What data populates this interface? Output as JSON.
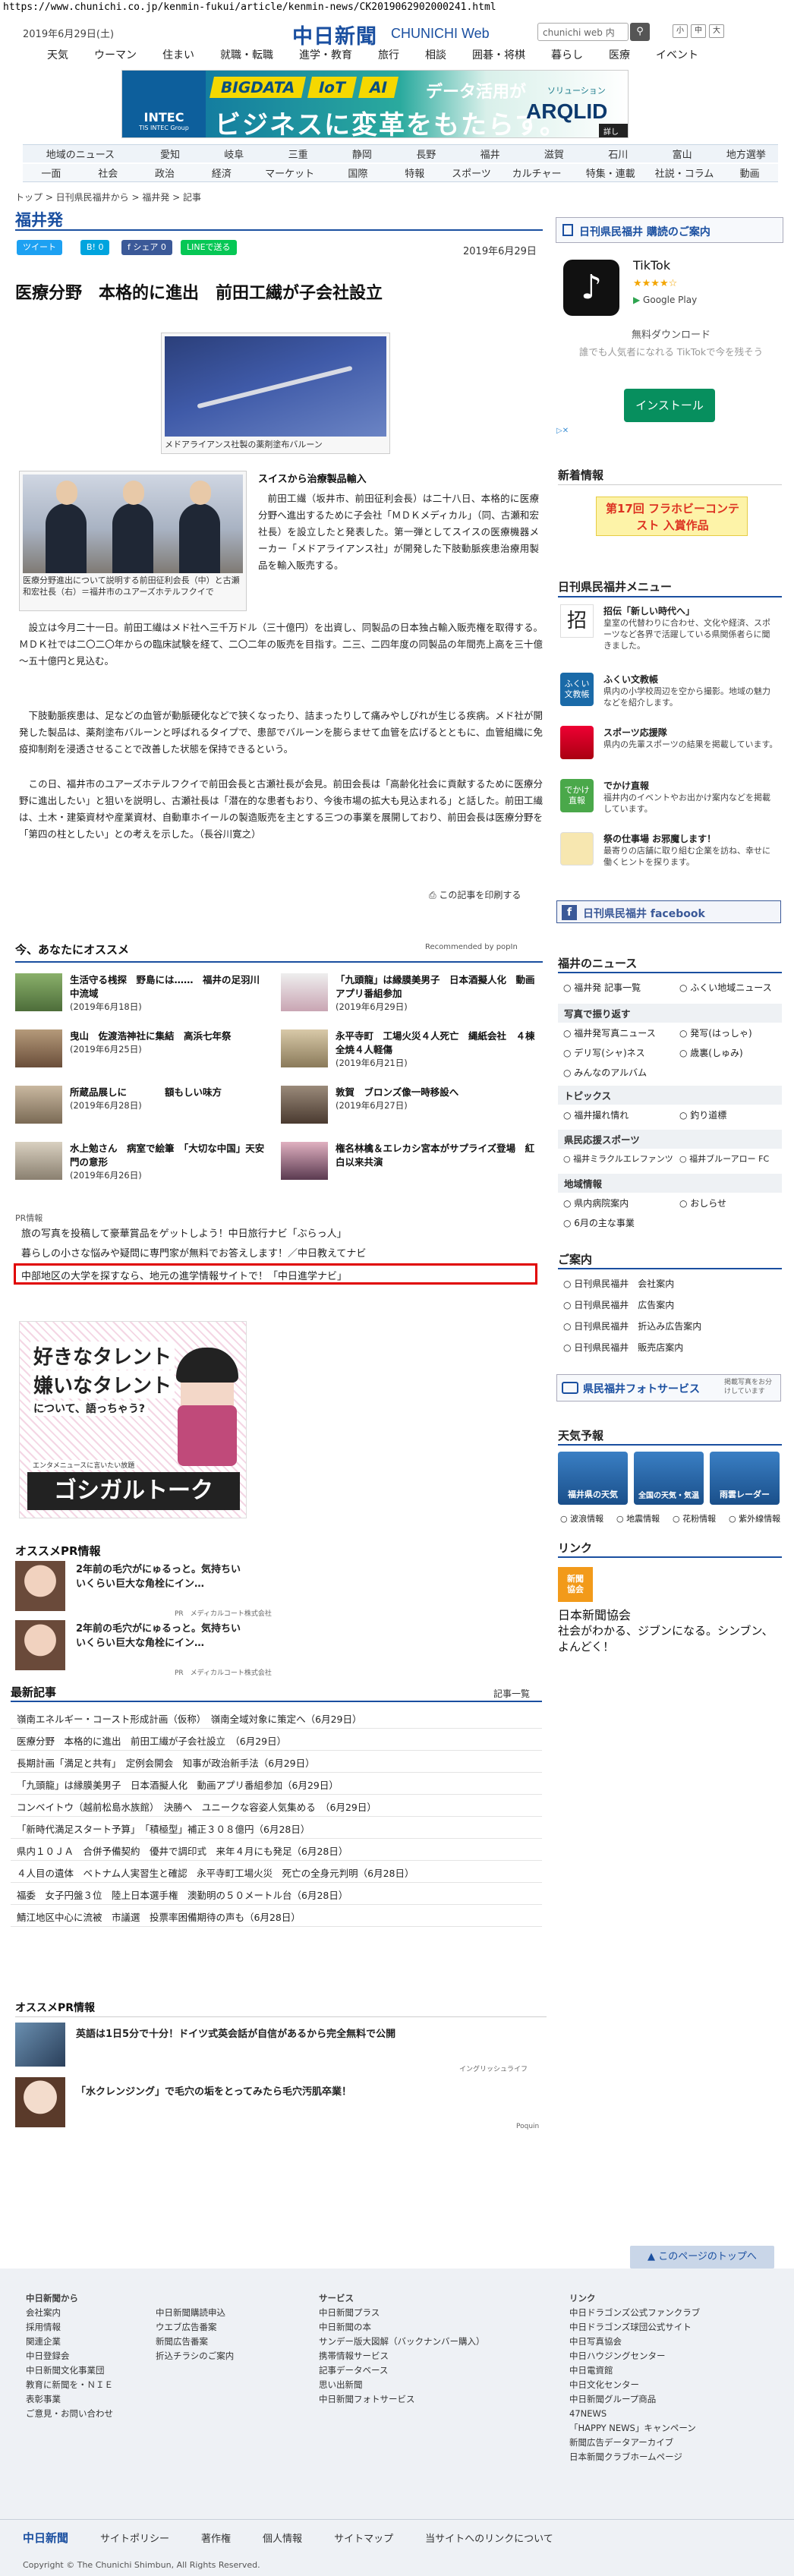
{
  "url": "https://www.chunichi.co.jp/kenmin-fukui/article/kenmin-news/CK2019062902000241.html",
  "header": {
    "date": "2019年6月29日(土)",
    "logo": "中日新聞",
    "logo_sub": "CHUNICHI Web",
    "search_placeholder": "chunichi web 内",
    "search_icon": "search-icon",
    "font_small": "小",
    "font_mid": "中",
    "font_large": "大",
    "nav": [
      "天気",
      "ウーマン",
      "住まい",
      "就職・転職",
      "進学・教育",
      "旅行",
      "相談",
      "囲碁・将棋",
      "暮らし",
      "医療",
      "イベント"
    ]
  },
  "banner": {
    "tags": [
      "BIGDATA",
      "IoT",
      "AI"
    ],
    "data": "データ活用が",
    "main": "ビジネスに変革をもたらす。",
    "company": "INTEC",
    "company_sub": "TIS INTEC Group",
    "product": "ARQLID",
    "product_sub": "ソリューション",
    "detail": "詳しくは"
  },
  "nav1": [
    "地域のニュース",
    "愛知",
    "岐阜",
    "三重",
    "静岡",
    "長野",
    "福井",
    "滋賀",
    "石川",
    "富山",
    "地方選挙"
  ],
  "nav2": [
    "一面",
    "社会",
    "政治",
    "経済",
    "マーケット",
    "国際",
    "特報",
    "スポーツ",
    "カルチャー",
    "特集・連載",
    "社説・コラム",
    "動画"
  ],
  "breadcrumb": "トップ > 日刊県民福井から > 福井発 > 記事",
  "section_title": "福井発",
  "share": {
    "tweet": "ツイート",
    "hatena": "B! 0",
    "share": "f シェア 0",
    "line": "LINEで送る"
  },
  "article": {
    "date": "2019年6月29日",
    "headline": "医療分野　本格的に進出　前田工繊が子会社設立",
    "photo1_caption": "メドアライアンス社製の薬剤塗布バルーン",
    "photo2_caption": "医療分野進出について説明する前田征利会長（中）と古瀬和宏社長（右）＝福井市のユアーズホテルフクイで",
    "subhead": "スイスから治療製品輸入",
    "p1": "前田工繊（坂井市、前田征利会長）は二十八日、本格的に医療分野へ進出するために子会社「ＭＤＫメディカル」（同、古瀬和宏社長）を設立したと発表した。第一弾としてスイスの医療機器メーカー「メドアライアンス社」が開発した下肢動脈疾患治療用製品を輸入販売する。",
    "p2": "設立は今月二十一日。前田工繊はメド社へ三千万ドル（三十億円）を出資し、同製品の日本独占輸入販売権を取得する。ＭＤＫ社では二〇二〇年からの臨床試験を経て、二〇二年の販売を目指す。二三、二四年度の同製品の年間売上高を三十億～五十億円と見込む。",
    "p3": "下肢動脈疾患は、足などの血管が動脈硬化などで狭くなったり、詰まったりして痛みやしびれが生じる疾病。メド社が開発した製品は、薬剤塗布バルーンと呼ばれるタイプで、患部でバルーンを膨らませて血管を広げるとともに、血管組織に免疫抑制剤を浸透させることで改善した状態を保持できるという。",
    "p4": "この日、福井市のユアーズホテルフクイで前田会長と古瀬社長が会見。前田会長は「高齢化社会に貢献するために医療分野に進出したい」と狙いを説明し、古瀬社長は「潜在的な患者もおり、今後市場の拡大も見込まれる」と話した。前田工繊は、土木・建築資材や産業資材、自動車ホイールの製造販売を主とする三つの事業を展開しており、前田会長は医療分野を「第四の柱としたい」との考えを示した。（長谷川寛之）",
    "print": "この記事を印刷する"
  },
  "recommend": {
    "title": "今、あなたにオススメ",
    "powered": "Recommended by popIn",
    "items": [
      {
        "t": "生活守る桟探　野島には……　福井の足羽川中流域",
        "d": "(2019年6月18日)"
      },
      {
        "t": "「九頭龍」は縁膜美男子　日本酒擬人化　動画アプリ番組参加",
        "d": "(2019年6月29日)"
      },
      {
        "t": "曳山　佐渡浩神社に集結　高浜七年祭",
        "d": "(2019年6月25日)"
      },
      {
        "t": "永平寺町　工場火災４人死亡　縄紙会社　４棟全焼４人軽傷",
        "d": "(2019年6月21日)"
      },
      {
        "t": "所蔵品展しに　　　　額もしい味方",
        "d": "(2019年6月28日)"
      },
      {
        "t": "敦賀　ブロンズ像一時移設へ",
        "d": "(2019年6月27日)"
      },
      {
        "t": "水上勉さん　病室で絵筆　「大切な中国」天安門の意形",
        "d": "(2019年6月26日)"
      },
      {
        "t": "権名林檎＆エレカシ宮本がサプライズ登場　紅白以来共演",
        "d": ""
      }
    ]
  },
  "pr": {
    "label": "PR情報",
    "items": [
      "旅の写真を投稿して豪華賞品をゲットしよう！中日旅行ナビ「ぶらっ人」",
      "暮らしの小さな悩みや疑問に専門家が無料でお答えします！／中日教えてナビ",
      "中部地区の大学を探すなら、地元の進学情報サイトで！「中日進学ナビ」"
    ]
  },
  "gossip": {
    "line1": "好きなタレント",
    "line2": "嫌いなタレント",
    "line3": "について、語っちゃう?",
    "small": "エンタメニュースに言いたい放題",
    "brand": "ゴシガルトーク"
  },
  "osusume_pr": {
    "title": "オススメPR情報",
    "items": [
      {
        "t": "2年前の毛穴がにゅるっと。気持ちいいくらい巨大な角栓にイン…",
        "s": "PR　メディカルコート株式会社"
      },
      {
        "t": "2年前の毛穴がにゅるっと。気持ちいいくらい巨大な角栓にイン…",
        "s": "PR　メディカルコート株式会社"
      }
    ]
  },
  "latest": {
    "title": "最新記事",
    "all": "記事一覧",
    "items": [
      "嶺南エネルギー・コースト形成計画（仮称）　嶺南全域対象に策定へ（6月29日）",
      "医療分野　本格的に進出　前田工繊が子会社設立　（6月29日）",
      "長期計画「満足と共有」　定例会開会　知事が政治新手法（6月29日）",
      "「九頭龍」は縁膜美男子　日本酒擬人化　動画アプリ番組参加（6月29日）",
      "コンベイトウ（越前松島水族館）　決勝へ　ユニークな容姿人気集める　（6月29日）",
      "「新時代満足スタート予算」　「積極型」補正３０８億円（6月28日）",
      "県内１０ＪＡ　合併予備契約　優井で調印式　来年４月にも発足（6月28日）",
      "４人目の遺体　ベトナム人実習生と確認　永平寺町工場火災　死亡の全身元判明（6月28日）",
      "福委　女子円盤３位　陸上日本選手権　澳勤明の５０メートル台（6月28日）",
      "鯖江地区中心に流被　市議選　投票率困備期待の声も（6月28日）"
    ]
  },
  "osusume_pr2": {
    "title": "オススメPR情報",
    "items": [
      "英語は1日5分で十分！ドイツ式英会話が自信があるから完全無料で公開",
      "「水クレンジング」で毛穴の垢をとってみたら毛穴汚肌卒業！"
    ],
    "sponsor": "イングリッシュライフ",
    "popin": "Poquin"
  },
  "sidebar": {
    "subscribe": "日刊県民福井 購読のご案内",
    "ad": {
      "name": "TikTok",
      "rating": "★★★★☆",
      "store": "Google Play",
      "free": "無料ダウンロード",
      "desc": "誰でも人気者になれる TikTokで今を残そう",
      "install": "インストール"
    },
    "arrivals": "新着情報",
    "contest": "第17回 フラホビーコンテスト 入賞作品",
    "menu_title": "日刊県民福井メニュー",
    "menu": [
      {
        "h": "招伝「新しい時代へ」",
        "p": "皇室の代替わりに合わせ、文化や経済、スポーツなど各界で活躍している県関係者らに聞きました。"
      },
      {
        "h": "ふくい文教帳",
        "p": "県内の小学校周辺を空から撮影。地域の魅力などを紹介します。"
      },
      {
        "h": "スポーツ応援隊",
        "p": "県内の先輩スポーツの結果を掲載しています。"
      },
      {
        "h": "でかけ直報",
        "p": "福井内のイベントやお出かけ案内などを掲載しています。"
      },
      {
        "h": "祭の仕事場 お邪魔します！",
        "p": "最寄りの店舗に取り組む企業を訪ね、幸せに働くヒントを探ります。"
      }
    ],
    "facebook": "日刊県民福井 facebook",
    "fukui_news": "福井のニュース",
    "fn_rows": [
      [
        "福井発 記事一覧",
        "ふくい地域ニュース"
      ]
    ],
    "photo_head": "写真で振り返す",
    "photo_rows": [
      [
        "福井発写真ニュース",
        "発写(はっしゃ)"
      ],
      [
        "デリ写(シャ)ネス",
        "歳裏(しゅみ)"
      ],
      [
        "みんなのアルバム",
        ""
      ]
    ],
    "topics_head": "トピックス",
    "topics_rows": [
      [
        "福井撮れ情れ",
        "釣り道標"
      ]
    ],
    "sports_head": "県民応援スポーツ",
    "sports_rows": [
      [
        "福井ミラクルエレファンツ",
        "福井ブルーアロー FC"
      ]
    ],
    "local_head": "地域情報",
    "local_rows": [
      [
        "県内病院案内",
        "おしらせ"
      ],
      [
        "6月の主な事業",
        ""
      ]
    ],
    "guide_head": "ご案内",
    "guide_rows": [
      "日刊県民福井　会社案内",
      "日刊県民福井　広告案内",
      "日刊県民福井　折込み広告案内",
      "日刊県民福井　販売店案内"
    ],
    "photoservice": "県民福井フォトサービス",
    "photo_sub": "掲載写真をお分けしています",
    "weather_head": "天気予報",
    "weather": [
      "福井県の天気",
      "全国の天気・気温",
      "雨雲レーダー"
    ],
    "weather_links": [
      "波浪情報",
      "地震情報",
      "花粉情報",
      "紫外線情報"
    ],
    "link_head": "リンク",
    "link_title": "日本新聞協会",
    "link_desc": "社会がわかる、ジブンになる。シンブン、よんどく！"
  },
  "footer": {
    "pagetop": "このページのトップへ",
    "col1": [
      "中日新聞から",
      "会社案内",
      "採用情報",
      "関連企業",
      "中日登録会",
      "中日新聞文化事業団",
      "教育に新聞を・ＮＩＥ",
      "表彰事業",
      "ご意見・お問い合わせ"
    ],
    "col2": [
      "中日新聞購読申込",
      "ウエブ広告番案",
      "新聞広告番案",
      "折込チラシのご案内"
    ],
    "col3_h": "サービス",
    "col3": [
      "中日新聞プラス",
      "中日新聞の本",
      "サンデー版大図解（バックナンバー購入）",
      "携帯情報サービス",
      "記事データベース",
      "思い出新聞",
      "中日新聞フォトサービス"
    ],
    "col4_h": "リンク",
    "col4": [
      "中日ドラゴンズ公式ファンクラブ",
      "中日ドラゴンズ球団公式サイト",
      "中日写真協会",
      "中日ハウジングセンター",
      "中日電資館",
      "中日文化センター",
      "中日新聞グループ商品",
      "47NEWS",
      "「HAPPY NEWS」キャンペーン",
      "新聞広告データアーカイブ",
      "日本新聞クラブホームページ"
    ],
    "btm": [
      "中日新聞",
      "サイトポリシー",
      "著作権",
      "個人情報",
      "サイトマップ",
      "当サイトへのリンクについて"
    ],
    "copyright": "Copyright © The Chunichi Shimbun, All Rights Reserved."
  },
  "colors": {
    "brand": "#1a4fa0",
    "pr_highlight": "#e00000",
    "line": "#06c755",
    "twitter": "#1da1f2",
    "hatena": "#00a4de",
    "facebook": "#3b5998"
  }
}
